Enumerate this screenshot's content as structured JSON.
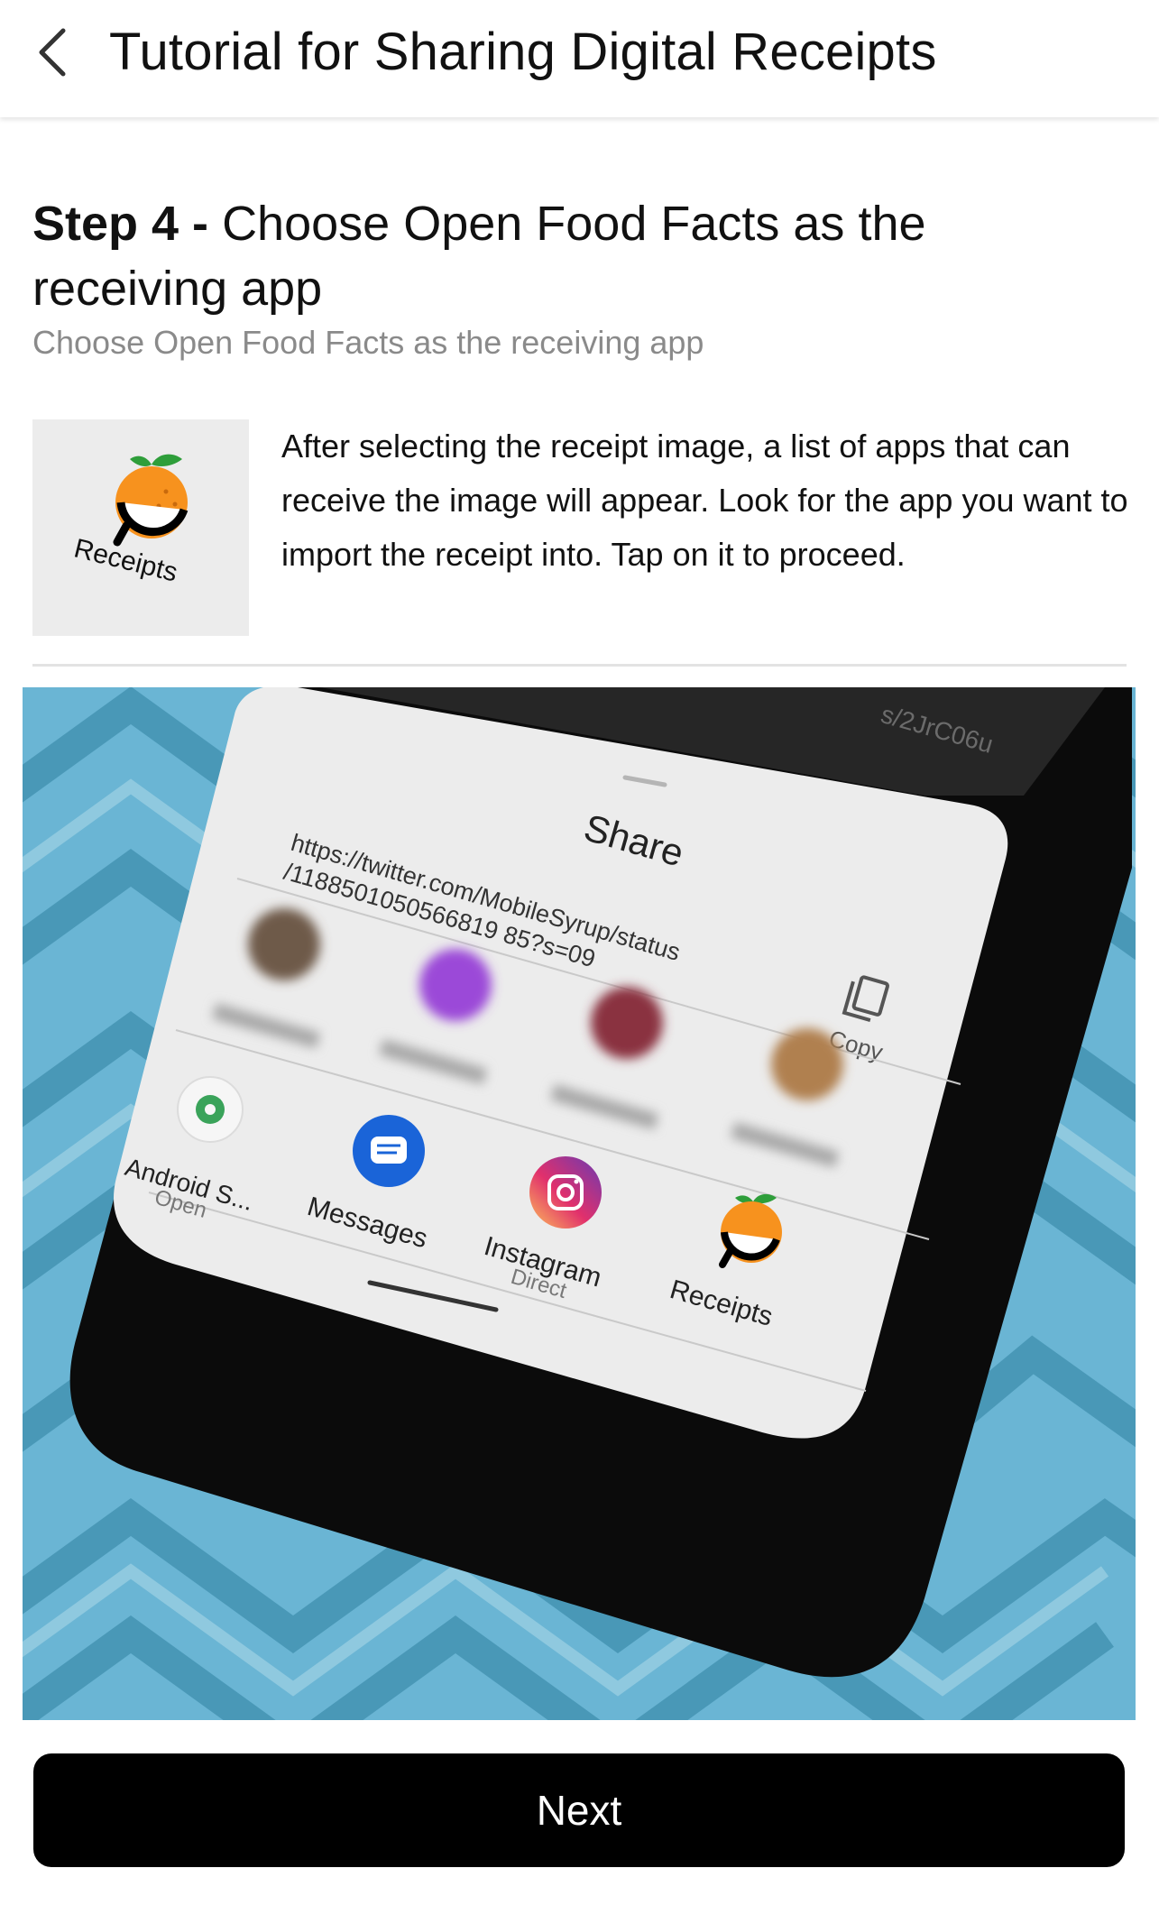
{
  "header": {
    "title": "Tutorial for Sharing Digital Receipts",
    "back_icon": "chevron-left-icon"
  },
  "step": {
    "label": "Step 4 -",
    "title": "Choose Open Food Facts as the receiving app",
    "subtitle": "Choose Open Food Facts as the receiving app",
    "description": "After selecting the receipt image, a list of apps that can receive the image will appear. Look for the app you want to import the receipt into. Tap on it to proceed.",
    "thumbnail_label": "Receipts"
  },
  "illustration": {
    "url_fragment": "s/2JrC06u",
    "share_title": "Share",
    "share_url_line1": "https://twitter.com/MobileSyrup/status",
    "share_url_line2": "/1188501050566819 85?s=09",
    "copy_label": "Copy",
    "apps": [
      {
        "name": "Android S...",
        "sub": "Open",
        "icon": "settings-gear-icon"
      },
      {
        "name": "Messages",
        "sub": "",
        "icon": "messages-icon"
      },
      {
        "name": "Instagram",
        "sub": "Direct",
        "icon": "instagram-icon"
      },
      {
        "name": "Receipts",
        "sub": "",
        "icon": "open-food-facts-icon"
      }
    ]
  },
  "footer": {
    "next_label": "Next"
  },
  "colors": {
    "accent_orange": "#f7921e",
    "leaf_green": "#2e9e3a",
    "button_black": "#000000",
    "subtitle_gray": "#8a8a8a",
    "mat_blue": "#6ab5d4"
  }
}
